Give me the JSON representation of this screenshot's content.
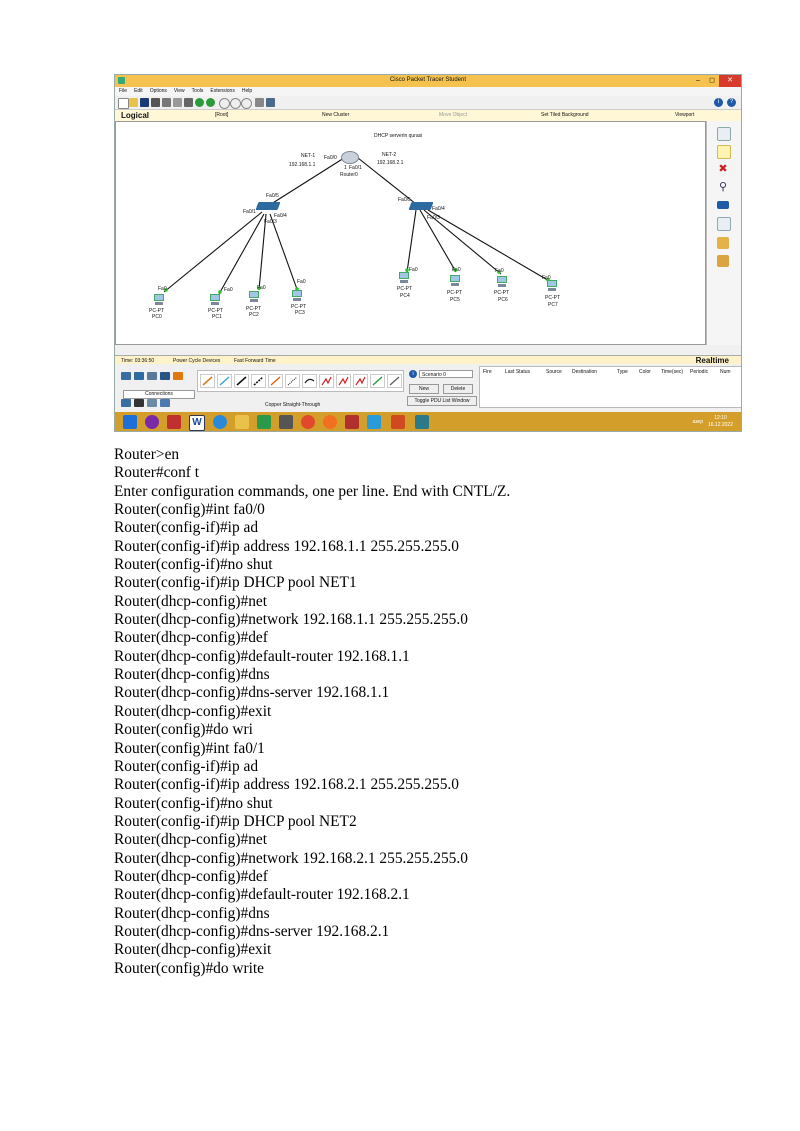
{
  "screenshot": {
    "window_title": "Cisco Packet Tracer Student",
    "menu": [
      "File",
      "Edit",
      "Options",
      "View",
      "Tools",
      "Extensions",
      "Help"
    ],
    "nav": {
      "logical": "Logical",
      "root": "[Root]",
      "new_cluster": "New Cluster",
      "move_object": "Move Object",
      "set_tiled_background": "Set Tiled Background",
      "viewport": "Viewport"
    },
    "canvas": {
      "caption": "DHCP serverin qurasi",
      "net1_label": "NET-1",
      "net1_ip": "192.168.1.1",
      "net2_label": "NET-2",
      "net2_ip": "192.168.2.1",
      "router_name": "Router0",
      "router_port0": "Fa0/0",
      "router_port1": "Fa0/1",
      "router_port1_prefix": "1",
      "sw1_ports": [
        "Fa0/5",
        "Fa0/1",
        "Fa0/4",
        "Fa0/3"
      ],
      "sw2_ports": [
        "Fa0/5",
        "Fa0/4",
        "Fa0/3"
      ],
      "pcs": [
        {
          "name": "PC0",
          "type": "PC-PT",
          "port": "Fa0"
        },
        {
          "name": "PC1",
          "type": "PC-PT",
          "port": "Fa0"
        },
        {
          "name": "PC2",
          "type": "PC-PT",
          "port": "Fa0"
        },
        {
          "name": "PC3",
          "type": "PC-PT",
          "port": "Fa0"
        },
        {
          "name": "PC4",
          "type": "PC-PT",
          "port": "Fa0"
        },
        {
          "name": "PC5",
          "type": "PC-PT",
          "port": "Fa0"
        },
        {
          "name": "PC6",
          "type": "PC-PT",
          "port": "Fa0"
        },
        {
          "name": "PC7",
          "type": "PC-PT",
          "port": "Fa0"
        }
      ]
    },
    "status": {
      "time": "Time: 03:36:50",
      "power_cycle": "Power Cycle Devices",
      "fast_forward": "Fast Forward Time",
      "realtime": "Realtime"
    },
    "bottom": {
      "connections": "Connections",
      "cable_name": "Copper Straight-Through",
      "scenario": "Scenario 0",
      "new": "New",
      "delete": "Delete",
      "toggle": "Toggle PDU List Window",
      "pdu_columns": [
        "Fire",
        "Last Status",
        "Source",
        "Destination",
        "Type",
        "Color",
        "Time(sec)",
        "Periodic",
        "Num"
      ]
    },
    "taskbar": {
      "lang": "азер",
      "time": "12:10",
      "date": "16.12.2022"
    },
    "colors": {
      "title_bar": "#f6c24f",
      "taskbar": "#d39f2a",
      "cable": "#111111",
      "link_ok": "#2fbf2f"
    }
  },
  "transcript": [
    "Router>en",
    "Router#conf t",
    "Enter configuration commands, one per line. End with CNTL/Z.",
    "Router(config)#int fa0/0",
    "Router(config-if)#ip ad",
    "Router(config-if)#ip address 192.168.1.1 255.255.255.0",
    "Router(config-if)#no shut",
    "Router(config-if)#ip DHCP pool NET1",
    "Router(dhcp-config)#net",
    "Router(dhcp-config)#network 192.168.1.1 255.255.255.0",
    "Router(dhcp-config)#def",
    "Router(dhcp-config)#default-router 192.168.1.1",
    "Router(dhcp-config)#dns",
    "Router(dhcp-config)#dns-server 192.168.1.1",
    "Router(dhcp-config)#exit",
    "Router(config)#do wri",
    "Router(config)#int fa0/1",
    "Router(config-if)#ip ad",
    "Router(config-if)#ip address 192.168.2.1 255.255.255.0",
    "Router(config-if)#no shut",
    "Router(config-if)#ip DHCP pool NET2",
    "Router(dhcp-config)#net",
    "Router(dhcp-config)#network 192.168.2.1 255.255.255.0",
    "Router(dhcp-config)#def",
    "Router(dhcp-config)#default-router 192.168.2.1",
    "Router(dhcp-config)#dns",
    "Router(dhcp-config)#dns-server 192.168.2.1",
    "Router(dhcp-config)#exit",
    "Router(config)#do write"
  ]
}
